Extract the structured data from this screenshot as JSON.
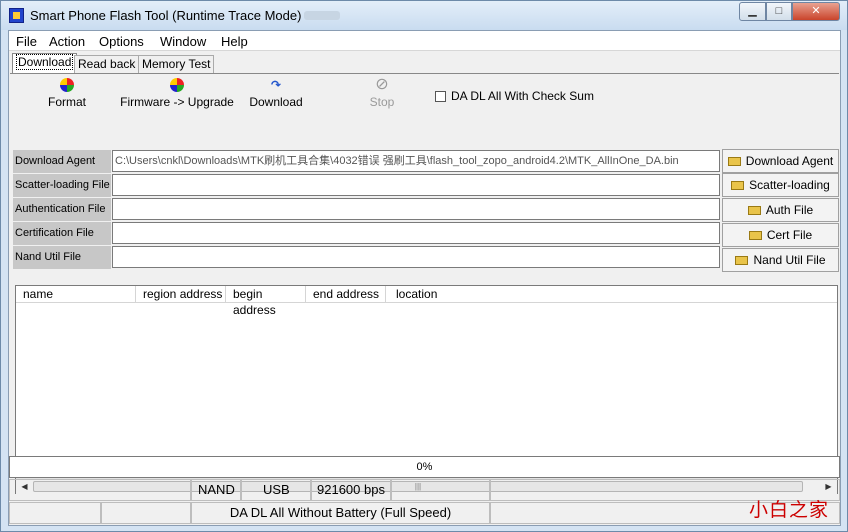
{
  "window": {
    "title": "Smart Phone Flash Tool (Runtime Trace Mode)"
  },
  "controls": {
    "minimize": "▁",
    "maximize": "□",
    "close": "✕"
  },
  "menu": [
    "File",
    "Action",
    "Options",
    "Window",
    "Help"
  ],
  "tabs": [
    "Download",
    "Read back",
    "Memory Test"
  ],
  "toolbar": {
    "format": "Format",
    "upgrade": "Firmware -> Upgrade",
    "download": "Download",
    "stop": "Stop",
    "checksum": "DA DL All With Check Sum"
  },
  "files": {
    "da": {
      "label": "Download Agent",
      "value": "C:\\Users\\cnkl\\Downloads\\MTK刷机工具合集\\4032错误 强刷工具\\flash_tool_zopo_android4.2\\MTK_AllInOne_DA.bin",
      "button": "Download Agent"
    },
    "scatter": {
      "label": "Scatter-loading File",
      "value": "",
      "button": "Scatter-loading"
    },
    "auth": {
      "label": "Authentication File",
      "value": "",
      "button": "Auth File"
    },
    "cert": {
      "label": "Certification File",
      "value": "",
      "button": "Cert File"
    },
    "nand": {
      "label": "Nand Util File",
      "value": "",
      "button": "Nand Util File"
    }
  },
  "list": {
    "columns": [
      "name",
      "region address",
      "begin address",
      "end address",
      "location"
    ]
  },
  "progress": {
    "label": "0%",
    "value": 0
  },
  "status": {
    "nand": "NAND",
    "usb": "USB",
    "baud": "921600 bps",
    "mode": "DA DL All Without Battery (Full Speed)"
  },
  "watermark": "小白之家"
}
